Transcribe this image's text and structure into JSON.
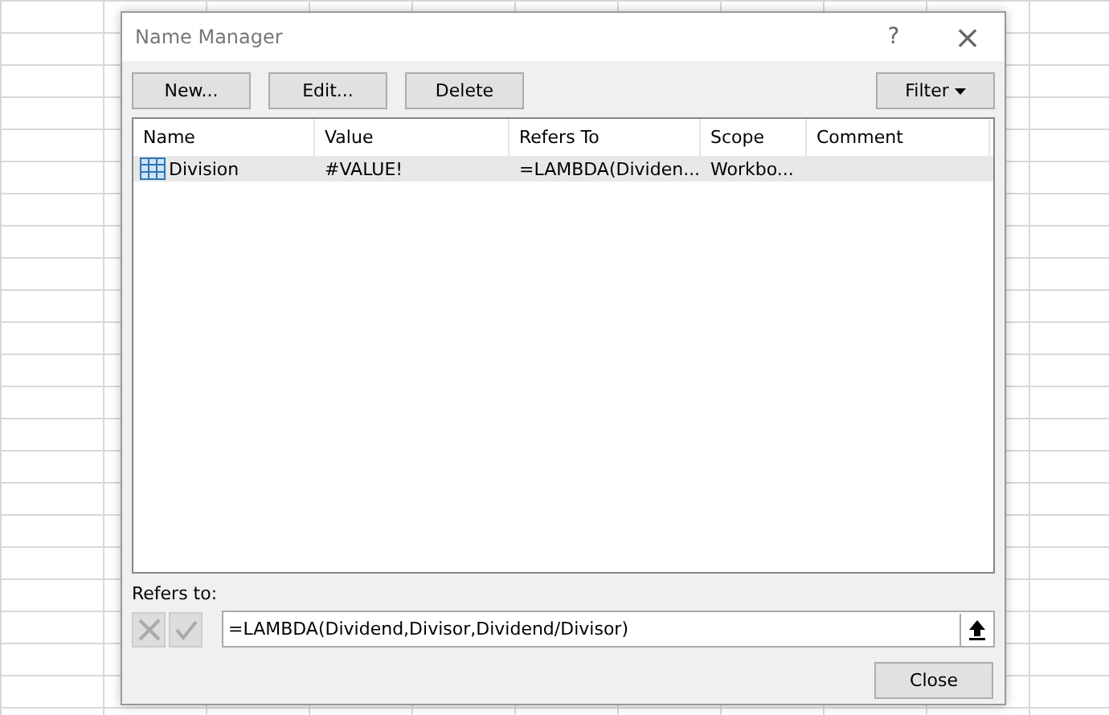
{
  "window": {
    "title": "Name Manager",
    "help": "?",
    "close": "×"
  },
  "toolbar": {
    "buttons": [
      "New...",
      "Edit...",
      "Delete"
    ],
    "filter": "Filter"
  },
  "table": {
    "columns": [
      "Name",
      "Value",
      "Refers To",
      "Scope",
      "Comment"
    ],
    "rows": [
      {
        "selected": true,
        "cells": [
          "Division",
          "#VALUE!",
          "=LAMBDA(Dividen...",
          "Workbo...",
          ""
        ]
      }
    ]
  },
  "refers_to": {
    "label": "Refers to:",
    "value": "=LAMBDA(Dividend,Divisor,Dividend/Divisor)",
    "cancel_disabled": true,
    "confirm_disabled": true
  },
  "buttons": [
    "Close"
  ]
}
